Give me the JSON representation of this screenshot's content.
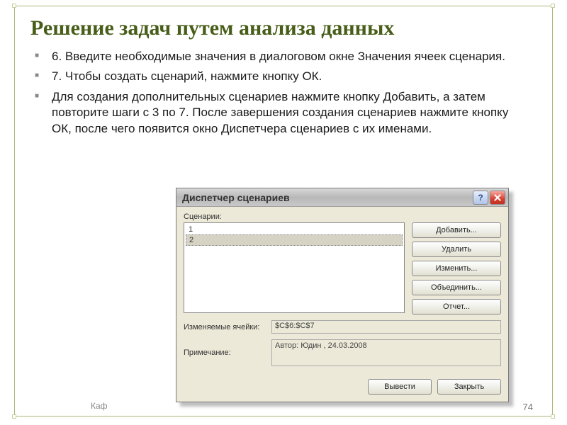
{
  "slide": {
    "title": "Решение задач путем анализа данных",
    "bullets": [
      "6. Введите необходимые значения в диалоговом окне Значения ячеек сценария.",
      "7. Чтобы создать сценарий, нажмите кнопку ОК.",
      "Для создания дополнительных сценариев нажмите кнопку Добавить, а затем повторите шаги с 3 по 7. После завершения создания сценариев нажмите кнопку ОК, после чего появится окно Диспетчера сценариев с их именами."
    ],
    "footer_frag": "Каф",
    "page": "74"
  },
  "dialog": {
    "title": "Диспетчер сценариев",
    "list_label": "Сценарии:",
    "scenarios": [
      "1",
      "2"
    ],
    "buttons": {
      "add": "Добавить...",
      "delete": "Удалить",
      "edit": "Изменить...",
      "merge": "Объединить...",
      "report": "Отчет..."
    },
    "cells_label": "Изменяемые ячейки:",
    "cells_value": "$C$6:$C$7",
    "note_label": "Примечание:",
    "note_value": "Автор: Юдин , 24.03.2008",
    "show": "Вывести",
    "close": "Закрыть",
    "help": "?"
  }
}
